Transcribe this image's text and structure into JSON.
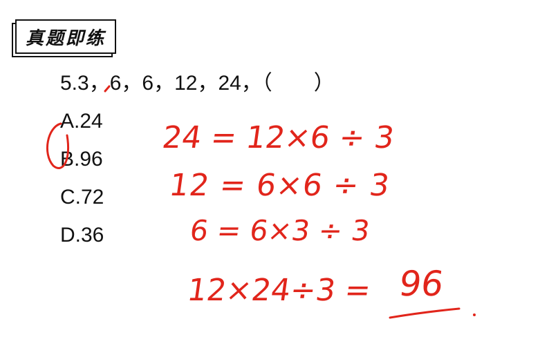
{
  "title_badge": {
    "label": "真题即练"
  },
  "question": {
    "stem": "5.3，6，6，12，24，（　　）"
  },
  "options": [
    {
      "label": "A.24"
    },
    {
      "label": "B.96"
    },
    {
      "label": "C.72"
    },
    {
      "label": "D.36"
    }
  ],
  "annotations": {
    "color": "#e1251b",
    "lines": [
      "24 = 12×6 ÷ 3",
      "12 = 6×6 ÷ 3",
      "6 = 6×3 ÷ 3"
    ],
    "final_expression": "12×24÷3 =",
    "final_result": "96",
    "circled_option_index": 1
  }
}
